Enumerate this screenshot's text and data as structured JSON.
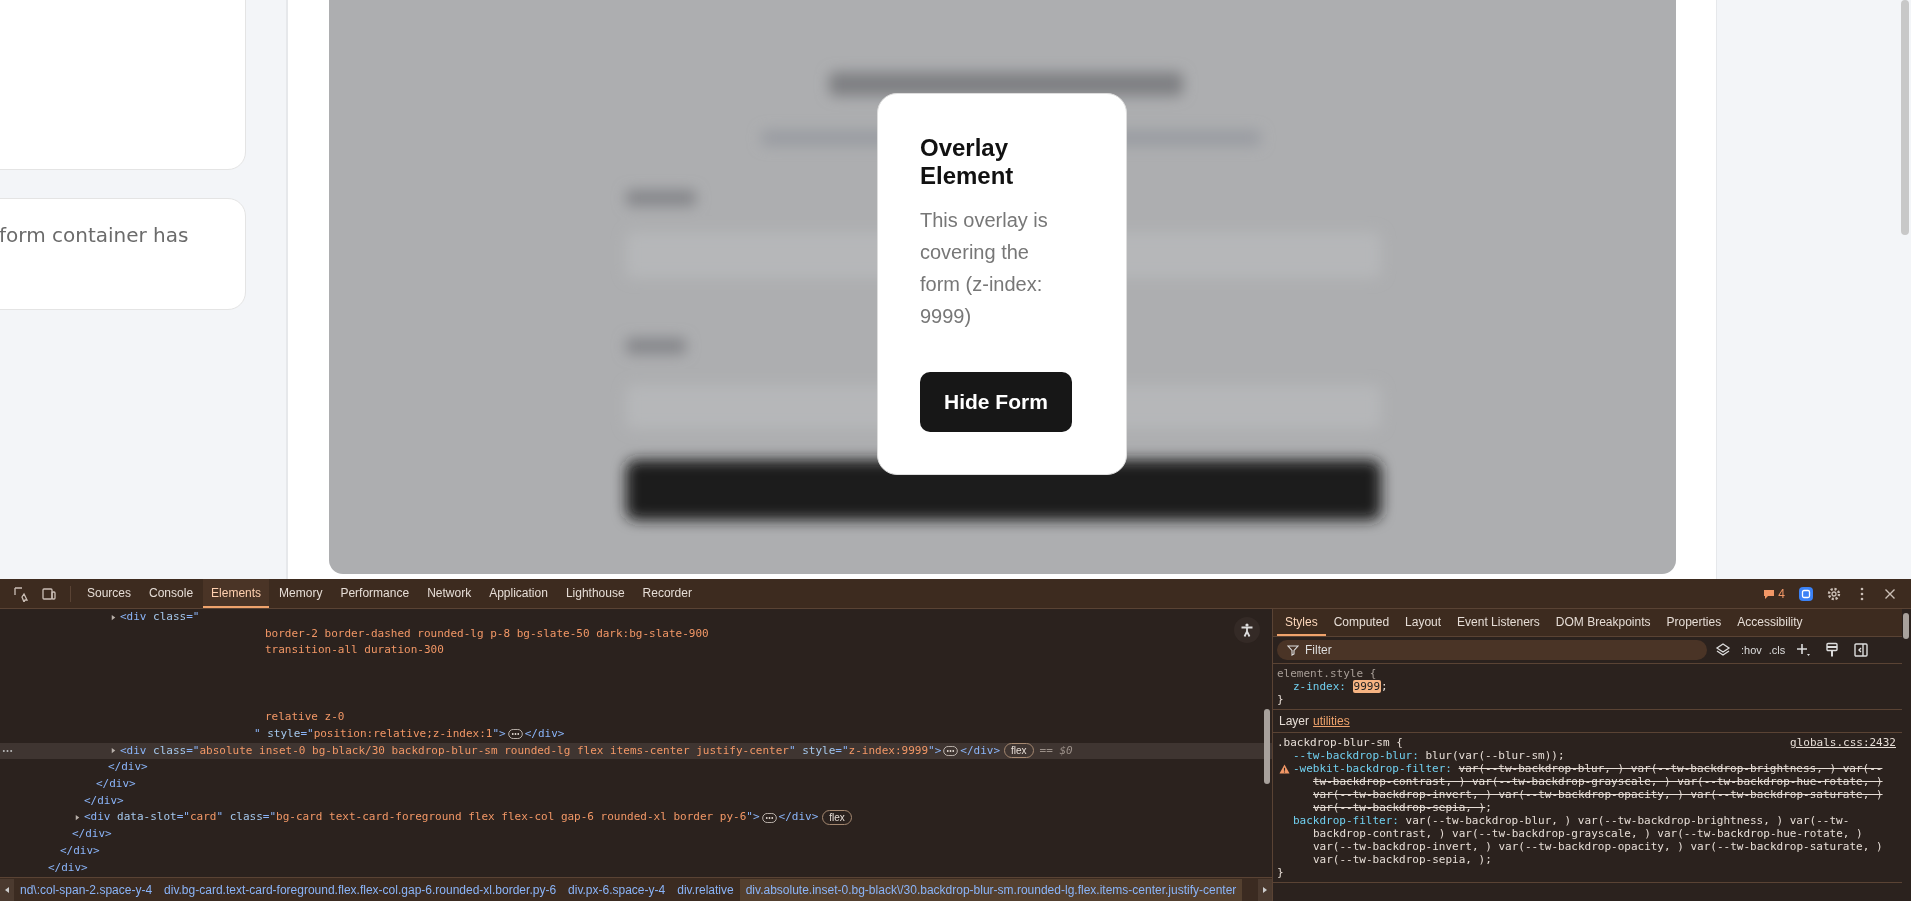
{
  "page": {
    "side_card_text": "form container has",
    "overlay": {
      "title": "Overlay Element",
      "description": "This overlay is covering the form (z-index: 9999)",
      "button": "Hide Form"
    }
  },
  "devtools": {
    "tabs": [
      {
        "label": "Sources",
        "selected": false
      },
      {
        "label": "Console",
        "selected": false
      },
      {
        "label": "Elements",
        "selected": true
      },
      {
        "label": "Memory",
        "selected": false
      },
      {
        "label": "Performance",
        "selected": false
      },
      {
        "label": "Network",
        "selected": false
      },
      {
        "label": "Application",
        "selected": false
      },
      {
        "label": "Lighthouse",
        "selected": false
      },
      {
        "label": "Recorder",
        "selected": false
      }
    ],
    "issues": "4",
    "elements": {
      "tree": [
        {
          "close": "</div>",
          "selected": false,
          "children": [
            {
              "close": "</div>",
              "selected": false,
              "children": [
                {
                  "close": "</div>",
                  "selected": false,
                  "children": [
                    {
                      "close": "</div>",
                      "selected": false,
                      "children": [
                        {
                          "close": "</div>",
                          "selected": false,
                          "children": [
                            {
                              "close": "</div>",
                              "selected": false,
                              "children": [
                                {
                                  "expanded": false,
                                  "selected": false,
                                  "open": [
                                    {
                                      "kind": "tag",
                                      "text": "<div"
                                    },
                                    {
                                      "kind": "attr",
                                      "text": " class"
                                    },
                                    {
                                      "kind": "punct",
                                      "text": "=\""
                                    }
                                  ],
                                  "wrapped": [
                                    {
                                      "text": "border-2 border-dashed rounded-lg p-8 bg-slate-50 dark:bg-slate-900",
                                      "spaced": false
                                    },
                                    {
                                      "text": "transition-all duration-300",
                                      "spaced": false
                                    },
                                    {
                                      "text": "relative z-0",
                                      "spaced": true
                                    }
                                  ],
                                  "tail": [
                                    {
                                      "kind": "punct",
                                      "text": "\""
                                    },
                                    {
                                      "kind": "attr",
                                      "text": " style"
                                    },
                                    {
                                      "kind": "punct",
                                      "text": "=\""
                                    },
                                    {
                                      "kind": "value",
                                      "text": "position:relative;z-index:1"
                                    },
                                    {
                                      "kind": "punct",
                                      "text": "\">"
                                    }
                                  ],
                                  "close": "</div>"
                                },
                                {
                                  "expanded": false,
                                  "selected": true,
                                  "open": [
                                    {
                                      "kind": "tag",
                                      "text": "<div"
                                    },
                                    {
                                      "kind": "attr",
                                      "text": " class"
                                    },
                                    {
                                      "kind": "punct",
                                      "text": "=\""
                                    },
                                    {
                                      "kind": "value",
                                      "text": "absolute inset-0 bg-black/30 backdrop-blur-sm rounded-lg flex items-center justify-center"
                                    },
                                    {
                                      "kind": "punct",
                                      "text": "\""
                                    },
                                    {
                                      "kind": "attr",
                                      "text": " style"
                                    },
                                    {
                                      "kind": "punct",
                                      "text": "=\""
                                    },
                                    {
                                      "kind": "value",
                                      "text": "z-index:9999"
                                    },
                                    {
                                      "kind": "punct",
                                      "text": "\">"
                                    }
                                  ],
                                  "close": "</div>",
                                  "badges": [
                                    "flex"
                                  ],
                                  "marker": "== $0"
                                }
                              ]
                            }
                          ]
                        }
                      ]
                    },
                    {
                      "expanded": false,
                      "selected": false,
                      "open": [
                        {
                          "kind": "tag",
                          "text": "<div"
                        },
                        {
                          "kind": "attr",
                          "text": " data-slot"
                        },
                        {
                          "kind": "punct",
                          "text": "=\""
                        },
                        {
                          "kind": "value",
                          "text": "card"
                        },
                        {
                          "kind": "punct",
                          "text": "\""
                        },
                        {
                          "kind": "attr",
                          "text": " class"
                        },
                        {
                          "kind": "punct",
                          "text": "=\""
                        },
                        {
                          "kind": "value",
                          "text": "bg-card text-card-foreground flex flex-col gap-6 rounded-xl border py-6"
                        },
                        {
                          "kind": "punct",
                          "text": "\">"
                        }
                      ],
                      "close": "</div>",
                      "badges": [
                        "flex"
                      ]
                    }
                  ]
                }
              ]
            }
          ]
        }
      ],
      "breadcrumbs": [
        {
          "label": "nd\\:col-span-2.space-y-4",
          "selected": false
        },
        {
          "label": "div.bg-card.text-card-foreground.flex.flex-col.gap-6.rounded-xl.border.py-6",
          "selected": false
        },
        {
          "label": "div.px-6.space-y-4",
          "selected": false
        },
        {
          "label": "div.relative",
          "selected": false
        },
        {
          "label": "div.absolute.inset-0.bg-black\\/30.backdrop-blur-sm.rounded-lg.flex.items-center.justify-center",
          "selected": true
        }
      ]
    },
    "styles": {
      "tabs": [
        {
          "label": "Styles",
          "selected": true
        },
        {
          "label": "Computed",
          "selected": false
        },
        {
          "label": "Layout",
          "selected": false
        },
        {
          "label": "Event Listeners",
          "selected": false
        },
        {
          "label": "DOM Breakpoints",
          "selected": false
        },
        {
          "label": "Properties",
          "selected": false
        },
        {
          "label": "Accessibility",
          "selected": false
        }
      ],
      "filter": {
        "placeholder": "Filter"
      },
      "tools": [
        ":hov",
        ".cls"
      ],
      "rules": [
        {
          "kind": "inline",
          "selector": "element.style",
          "open": "{",
          "close": "}",
          "declarations": [
            {
              "property": "z-index:",
              "value": "9999",
              "end": ";",
              "highlighted": true,
              "overridden": false,
              "warning": false
            }
          ]
        },
        {
          "kind": "layer",
          "label": "Layer",
          "link": "utilities"
        },
        {
          "kind": "rule",
          "selector": ".backdrop-blur-sm",
          "open": "{",
          "close": "}",
          "source": "globals.css:2432",
          "declarations": [
            {
              "property": "--tw-backdrop-blur:",
              "value": "blur(var(--blur-sm))",
              "end": ";",
              "highlighted": false,
              "overridden": false,
              "warning": false
            },
            {
              "property": "-webkit-backdrop-filter:",
              "value": "var(--tw-backdrop-blur, ) var(--tw-backdrop-brightness, ) var(--tw-backdrop-contrast, ) var(--tw-backdrop-grayscale, ) var(--tw-backdrop-hue-rotate, ) var(--tw-backdrop-invert, ) var(--tw-backdrop-opacity, ) var(--tw-backdrop-saturate, ) var(--tw-backdrop-sepia, )",
              "end": ";",
              "highlighted": false,
              "overridden": true,
              "warning": true
            },
            {
              "property": "backdrop-filter:",
              "value": "var(--tw-backdrop-blur, ) var(--tw-backdrop-brightness, ) var(--tw-backdrop-contrast, ) var(--tw-backdrop-grayscale, ) var(--tw-backdrop-hue-rotate, ) var(--tw-backdrop-invert, ) var(--tw-backdrop-opacity, ) var(--tw-backdrop-saturate, ) var(--tw-backdrop-sepia, )",
              "end": ";",
              "highlighted": false,
              "overridden": false,
              "warning": false
            }
          ]
        }
      ]
    }
  }
}
